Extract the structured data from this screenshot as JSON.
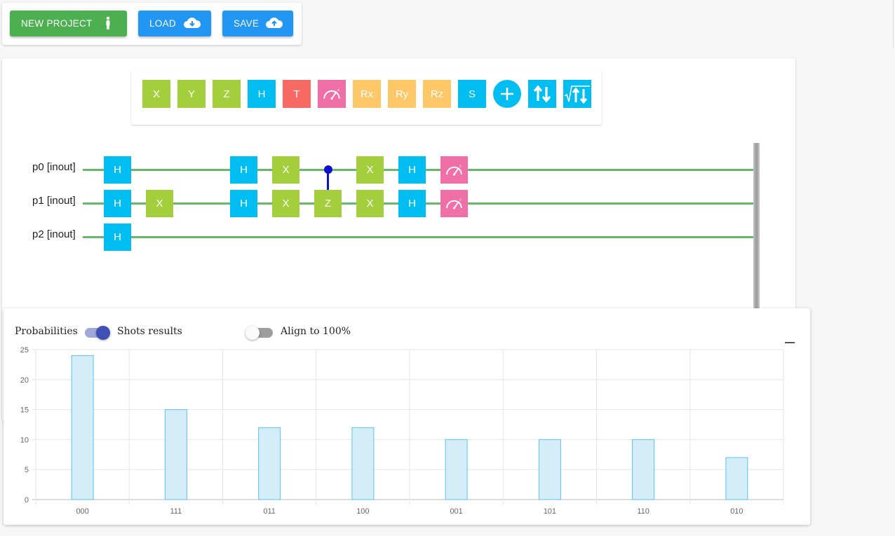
{
  "toolbar": {
    "new_project": "NEW PROJECT",
    "load": "LOAD",
    "save": "SAVE"
  },
  "palette": {
    "gates": [
      {
        "label": "X",
        "color": "#a4cf3c"
      },
      {
        "label": "Y",
        "color": "#a4cf3c"
      },
      {
        "label": "Z",
        "color": "#a4cf3c"
      },
      {
        "label": "H",
        "color": "#00bdf2"
      },
      {
        "label": "T",
        "color": "#f86a64"
      },
      {
        "label": "",
        "icon": "measure-icon",
        "color": "#f06fa7"
      },
      {
        "label": "Rx",
        "color": "#fec868"
      },
      {
        "label": "Ry",
        "color": "#fec868"
      },
      {
        "label": "Rz",
        "color": "#fec868"
      },
      {
        "label": "S",
        "color": "#00bdf2"
      },
      {
        "label": "",
        "icon": "add-control-icon",
        "color": "#00bdf2"
      },
      {
        "label": "",
        "icon": "swap-icon",
        "color": "#00bdf2"
      },
      {
        "label": "",
        "icon": "sqrt-swap-icon",
        "color": "#00bdf2"
      }
    ]
  },
  "circuit": {
    "qubits": [
      "p0 [inout]",
      "p1 [inout]",
      "p2 [inout]"
    ],
    "wire_color": "#66bb6a",
    "gates": [
      {
        "q": 0,
        "col": 0,
        "label": "H",
        "color": "#00bdf2"
      },
      {
        "q": 1,
        "col": 0,
        "label": "H",
        "color": "#00bdf2"
      },
      {
        "q": 2,
        "col": 0,
        "label": "H",
        "color": "#00bdf2"
      },
      {
        "q": 1,
        "col": 1,
        "label": "X",
        "color": "#a4cf3c"
      },
      {
        "q": 0,
        "col": 3,
        "label": "H",
        "color": "#00bdf2"
      },
      {
        "q": 1,
        "col": 3,
        "label": "H",
        "color": "#00bdf2"
      },
      {
        "q": 0,
        "col": 4,
        "label": "X",
        "color": "#a4cf3c"
      },
      {
        "q": 1,
        "col": 4,
        "label": "X",
        "color": "#a4cf3c"
      },
      {
        "q": 1,
        "col": 5,
        "label": "Z",
        "color": "#a4cf3c",
        "control": 0
      },
      {
        "q": 0,
        "col": 6,
        "label": "X",
        "color": "#a4cf3c"
      },
      {
        "q": 1,
        "col": 6,
        "label": "X",
        "color": "#a4cf3c"
      },
      {
        "q": 0,
        "col": 7,
        "label": "H",
        "color": "#00bdf2"
      },
      {
        "q": 1,
        "col": 7,
        "label": "H",
        "color": "#00bdf2"
      },
      {
        "q": 0,
        "col": 8,
        "label": "",
        "icon": "measure-icon",
        "color": "#f06fa7"
      },
      {
        "q": 1,
        "col": 8,
        "label": "",
        "icon": "measure-icon",
        "color": "#f06fa7"
      }
    ]
  },
  "results": {
    "probabilities_label": "Probabilities",
    "shots_label": "Shots results",
    "shots_enabled": true,
    "align_label": "Align to 100%",
    "align_enabled": false
  },
  "chart_data": {
    "type": "bar",
    "categories": [
      "000",
      "111",
      "011",
      "100",
      "001",
      "101",
      "110",
      "010"
    ],
    "values": [
      24,
      15,
      12,
      12,
      10,
      10,
      10,
      7
    ],
    "ylim": [
      0,
      25
    ],
    "yticks": [
      0,
      5,
      10,
      15,
      20,
      25
    ],
    "grid": true,
    "bar_fill": "#d4edf9",
    "bar_stroke": "#59c3ea"
  }
}
